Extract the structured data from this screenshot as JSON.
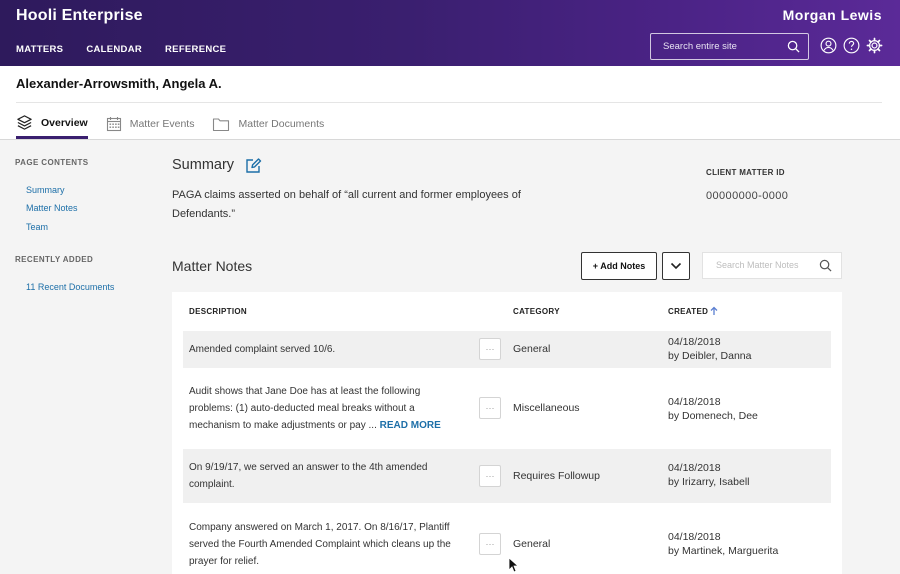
{
  "header": {
    "brand": "Hooli Enterprise",
    "firm": "Morgan Lewis",
    "nav": [
      "MATTERS",
      "CALENDAR",
      "REFERENCE"
    ],
    "search_placeholder": "Search entire site",
    "icons": [
      "user-icon",
      "help-icon",
      "gear-icon"
    ]
  },
  "client": {
    "name": "Alexander-Arrowsmith, Angela A.",
    "tabs": [
      {
        "label": "Overview",
        "icon": "layers-icon",
        "active": true
      },
      {
        "label": "Matter Events",
        "icon": "calendar-icon",
        "active": false
      },
      {
        "label": "Matter Documents",
        "icon": "folder-icon",
        "active": false
      }
    ]
  },
  "sidebar": {
    "page_contents_heading": "PAGE CONTENTS",
    "links": [
      "Summary",
      "Matter Notes",
      "Team"
    ],
    "recently_added_heading": "RECENTLY ADDED",
    "recent_link": "11 Recent Documents"
  },
  "summary": {
    "title": "Summary",
    "text": "PAGA claims asserted on behalf of “all current and former employees of Defendants.”",
    "client_matter_id_label": "CLIENT MATTER ID",
    "client_matter_id": "00000000-0000"
  },
  "notes": {
    "title": "Matter Notes",
    "add_label": "+ Add Notes",
    "search_placeholder": "Search Matter Notes",
    "columns": [
      "DESCRIPTION",
      "CATEGORY",
      "CREATED"
    ],
    "more_label": "···",
    "rows": [
      {
        "description": "Amended complaint served 10/6.",
        "read_more": "",
        "category": "General",
        "date": "04/18/2018",
        "by": "by Deibler, Danna"
      },
      {
        "description": "Audit shows that Jane Doe has at least the following problems: (1) auto-deducted meal breaks without a mechanism to make adjustments or pay ...",
        "read_more": "READ MORE",
        "category": "Miscellaneous",
        "date": "04/18/2018",
        "by": "by Domenech, Dee"
      },
      {
        "description": "On 9/19/17, we served an answer to the 4th amended complaint.",
        "read_more": "",
        "category": "Requires Followup",
        "date": "04/18/2018",
        "by": "by Irizarry, Isabell"
      },
      {
        "description": "Company answered on March 1, 2017. On 8/16/17, Plantiff served the Fourth Amended Complaint which cleans up the prayer for relief.",
        "read_more": "",
        "category": "General",
        "date": "04/18/2018",
        "by": "by Martinek, Marguerita"
      }
    ]
  },
  "colors": {
    "header_start": "#2e1a5c",
    "header_end": "#5b2a98",
    "link": "#1d6fa8",
    "row_shade": "#f0f0f0"
  }
}
